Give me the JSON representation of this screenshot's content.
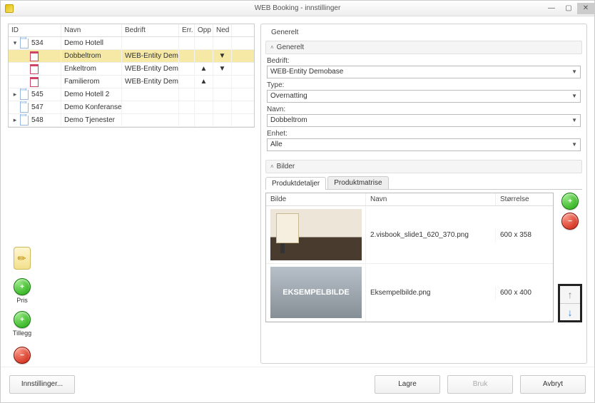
{
  "window": {
    "title": "WEB Booking - innstillinger",
    "min_label": "—",
    "max_label": "▢",
    "close_label": "✕"
  },
  "tree": {
    "headers": {
      "id": "ID",
      "navn": "Navn",
      "bedrift": "Bedrift",
      "err": "Err.",
      "opp": "Opp",
      "ned": "Ned"
    },
    "rows": [
      {
        "exp": "▾",
        "id": "534",
        "navn": "Demo Hotell",
        "bedrift": "",
        "opp": "",
        "ned": "",
        "type": "folder",
        "level": 0
      },
      {
        "exp": "",
        "id": "",
        "navn": "Dobbeltrom",
        "bedrift": "WEB-Entity Demobase",
        "opp": "",
        "ned": "▼",
        "type": "cal",
        "level": 1,
        "selected": true
      },
      {
        "exp": "",
        "id": "",
        "navn": "Enkeltrom",
        "bedrift": "WEB-Entity Demobase",
        "opp": "▲",
        "ned": "▼",
        "type": "cal",
        "level": 1
      },
      {
        "exp": "",
        "id": "",
        "navn": "Familierom",
        "bedrift": "WEB-Entity Demobase",
        "opp": "▲",
        "ned": "",
        "type": "cal",
        "level": 1
      },
      {
        "exp": "▸",
        "id": "545",
        "navn": "Demo Hotell 2",
        "bedrift": "",
        "opp": "",
        "ned": "",
        "type": "folder",
        "level": 0
      },
      {
        "exp": "",
        "id": "547",
        "navn": "Demo Konferansesenter",
        "bedrift": "",
        "opp": "",
        "ned": "",
        "type": "folder",
        "level": 0
      },
      {
        "exp": "▸",
        "id": "548",
        "navn": "Demo Tjenester",
        "bedrift": "",
        "opp": "",
        "ned": "",
        "type": "folder",
        "level": 0
      }
    ]
  },
  "side": {
    "pris": "Pris",
    "tillegg": "Tillegg",
    "add_glyph": "+",
    "remove_glyph": "−"
  },
  "panel": {
    "generelt_outer": "Generelt",
    "generelt": "Generelt",
    "labels": {
      "bedrift": "Bedrift:",
      "type": "Type:",
      "navn": "Navn:",
      "enhet": "Enhet:"
    },
    "values": {
      "bedrift": "WEB-Entity Demobase",
      "type": "Overnatting",
      "navn": "Dobbeltrom",
      "enhet": "Alle"
    },
    "bilder": "Bilder",
    "tabs": {
      "detaljer": "Produktdetaljer",
      "matrise": "Produktmatrise"
    },
    "img_headers": {
      "bilde": "Bilde",
      "navn": "Navn",
      "storrelse": "Størrelse"
    },
    "images": [
      {
        "navn": "2.visbook_slide1_620_370.png",
        "storrelse": "600 x 358",
        "thumb_text": "",
        "thumb_class": "room"
      },
      {
        "navn": "Eksempelbilde.png",
        "storrelse": "600 x 400",
        "thumb_text": "EKSEMPELBILDE",
        "thumb_class": "sample"
      }
    ]
  },
  "footer": {
    "innstillinger": "Innstillinger...",
    "lagre": "Lagre",
    "bruk": "Bruk",
    "avbryt": "Avbryt"
  }
}
